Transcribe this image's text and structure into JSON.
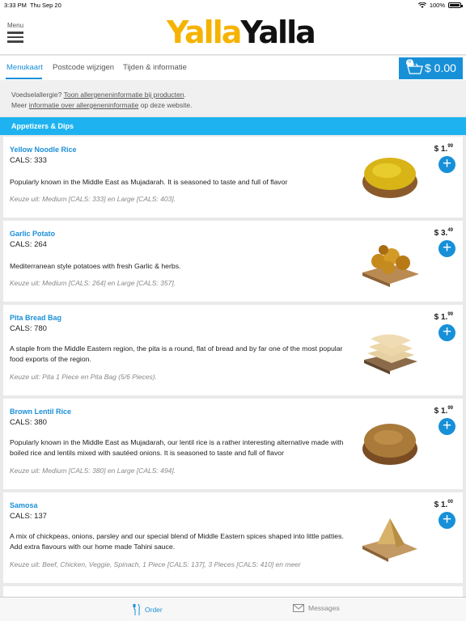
{
  "status": {
    "time": "3:33 PM",
    "date": "Thu Sep 20",
    "battery": "100%"
  },
  "header": {
    "menu_label": "Menu",
    "logo_part1": "Yalla",
    "logo_part2": "Yalla"
  },
  "tabs": [
    {
      "label": "Menukaart",
      "active": true
    },
    {
      "label": "Postcode wijzigen",
      "active": false
    },
    {
      "label": "Tijden & informatie",
      "active": false
    }
  ],
  "cart": {
    "count": "0",
    "total": "$ 0.00"
  },
  "info": {
    "line1_prefix": "Voedselallergie? ",
    "line1_link": "Toon allergeneninformatie bij producten",
    "line1_suffix": ".",
    "line2_prefix": "Meer ",
    "line2_link": "informatie over allergeneninformatie",
    "line2_suffix": " op deze website."
  },
  "section": {
    "title": "Appetizers & Dips"
  },
  "items": [
    {
      "name": "Yellow Noodle Rice",
      "cals": "CALS: 333",
      "description": "Popularly known in the Middle East as Mujadarah. It is seasoned to taste and full of flavor",
      "options": "Keuze uit: Medium [CALS: 333] en Large [CALS: 403].",
      "price_main": "$ 1.",
      "price_cents": "99",
      "image": "yellow-rice-bowl"
    },
    {
      "name": "Garlic Potato",
      "cals": "CALS: 264",
      "description": "Mediterranean style potatoes with fresh Garlic & herbs.",
      "options": "Keuze uit: Medium [CALS: 264] en Large [CALS: 357].",
      "price_main": "$ 3.",
      "price_cents": "49",
      "image": "potatoes-board"
    },
    {
      "name": "Pita Bread Bag",
      "cals": "CALS: 780",
      "description": "A staple from the Middle Eastern region, the pita is a round, flat of bread and by far one of the most popular food exports of the region.",
      "options": "Keuze uit: Pita 1 Piece en Pita Bag (5/6 Pieces).",
      "price_main": "$ 1.",
      "price_cents": "99",
      "image": "pita-stack"
    },
    {
      "name": "Brown Lentil Rice",
      "cals": "CALS: 380",
      "description": "Popularly known in the Middle East as Mujadarah, our lentil rice is a rather interesting alternative made with boiled rice and lentils mixed with sautéed onions. It is seasoned to taste and full of flavor",
      "options": "Keuze uit: Medium [CALS: 380] en Large [CALS: 494].",
      "price_main": "$ 1.",
      "price_cents": "99",
      "image": "lentil-rice-bowl"
    },
    {
      "name": "Samosa",
      "cals": "CALS: 137",
      "description": "A mix of chickpeas, onions, parsley and our special blend of Middle Eastern spices shaped into little patties. Add extra flavours with our home made Tahini sauce.",
      "options": "Keuze uit: Beef, Chicken, Veggie, Spinach, 1 Piece [CALS: 137], 3 Pieces [CALS: 410] en meer",
      "price_main": "$ 1.",
      "price_cents": "00",
      "image": "samosa-board"
    }
  ],
  "bottom_nav": [
    {
      "label": "Order",
      "icon": "cutlery-icon",
      "active": true
    },
    {
      "label": "Messages",
      "icon": "envelope-icon",
      "active": false
    }
  ],
  "colors": {
    "accent": "#1790d8",
    "section": "#1eb3f0",
    "logo_yellow": "#f5b300"
  }
}
